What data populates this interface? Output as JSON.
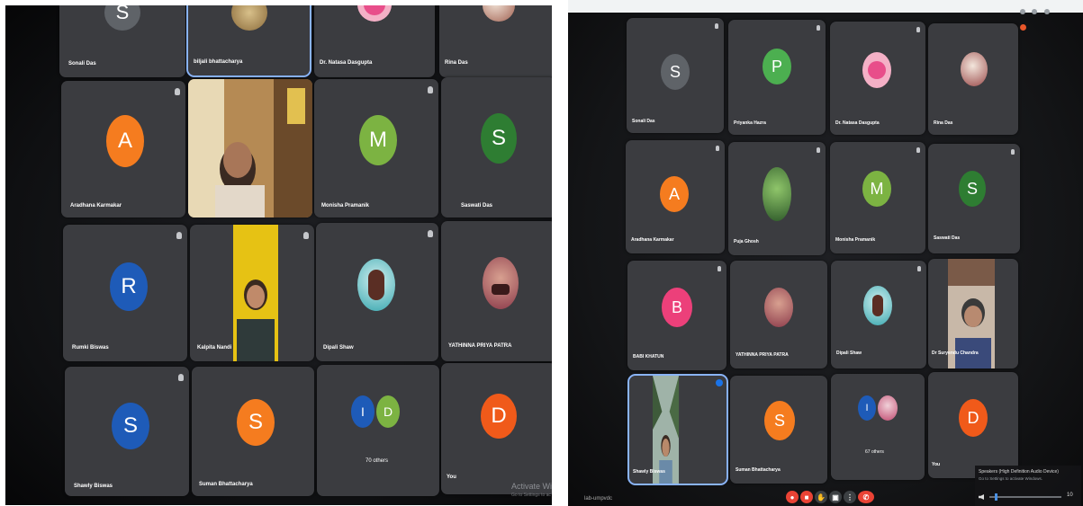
{
  "left": {
    "tiles": [
      {
        "name": "Sonali Das",
        "initial": "S"
      },
      {
        "name": "biljali bhattacharya"
      },
      {
        "name": "Dr. Natasa Dasgupta"
      },
      {
        "name": "Rina Das"
      },
      {
        "name": "Aradhana Karmakar",
        "initial": "A"
      },
      {
        "name": "Monisha Pramanik",
        "initial": "M"
      },
      {
        "name": "Saswati Das",
        "initial": "S"
      },
      {
        "name": "Rumki Biswas",
        "initial": "R"
      },
      {
        "name": "Kalpita Nandi"
      },
      {
        "name": "Dipali Shaw"
      },
      {
        "name": "YATHINNA PRIYA PATRA"
      },
      {
        "name": "Shawly Biswas",
        "initial": "S"
      },
      {
        "name": "Suman Bhattacharya",
        "initial": "S"
      },
      {
        "name": "70 others",
        "a": "I",
        "b": "D"
      },
      {
        "name": "You",
        "initial": "D"
      }
    ],
    "watermark_line1": "Activate Wind",
    "watermark_line2": "Go to Settings to ac"
  },
  "right": {
    "tiles": [
      {
        "name": "Sonali Das",
        "initial": "S"
      },
      {
        "name": "Priyanka Hazra",
        "initial": "P"
      },
      {
        "name": "Dr. Natasa Dasgupta"
      },
      {
        "name": "Rina Das"
      },
      {
        "name": "Aradhana Karmakar",
        "initial": "A"
      },
      {
        "name": "Puja Ghosh"
      },
      {
        "name": "Monisha Pramanik",
        "initial": "M"
      },
      {
        "name": "Saswati Das",
        "initial": "S"
      },
      {
        "name": "BABI KHATUN",
        "initial": "B"
      },
      {
        "name": "YATHINNA PRIYA PATRA"
      },
      {
        "name": "Dipali Shaw"
      },
      {
        "name": "Dr Suryendu Chandra"
      },
      {
        "name": "Shawly Biswas"
      },
      {
        "name": "Suman Bhattacharya",
        "initial": "S"
      },
      {
        "name": "67 others",
        "a": "I"
      },
      {
        "name": "You",
        "initial": "D"
      }
    ],
    "audio_popup_title": "Speakers (High Definition Audio Device)",
    "audio_popup_sub": "Go to Settings to activate Windows.",
    "volume_value": "10",
    "meeting_code": "lab-umpvdc"
  },
  "colors": {
    "orange": "#f57c1f",
    "green_light": "#7cb342",
    "green_dark": "#2e7d32",
    "blue": "#1e5bb8",
    "pink": "#ec407a",
    "end_call": "#ea4335"
  }
}
